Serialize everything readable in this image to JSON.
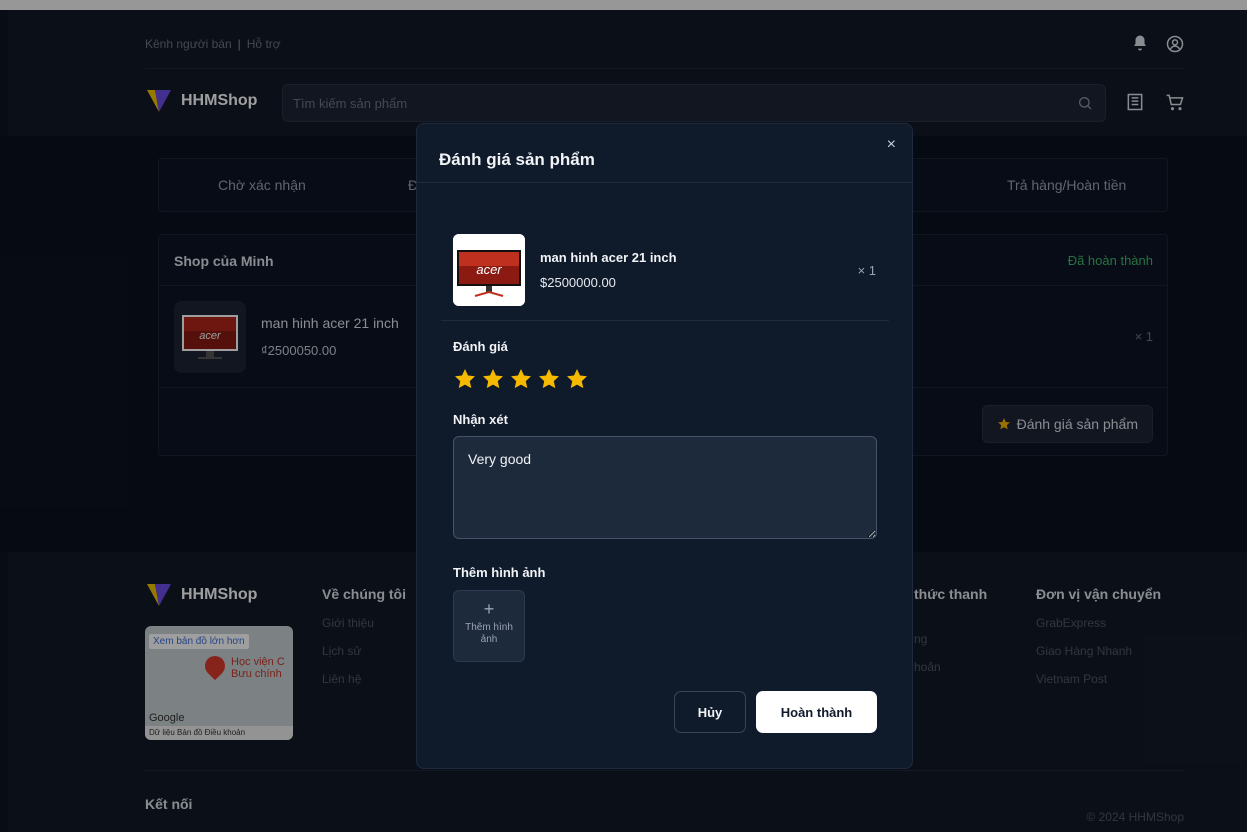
{
  "header": {
    "seller_channel": "Kênh người bán",
    "divider": "|",
    "support": "Hỗ trợ",
    "brand": "HHMShop",
    "search_placeholder": "Tìm kiếm sản phẩm"
  },
  "tabs": [
    {
      "label": "Chờ xác nhận"
    },
    {
      "label": "Đ"
    },
    {
      "label": "Trả hàng/Hoàn tiền"
    }
  ],
  "order": {
    "shop_name": "Shop của Minh",
    "status": "Đã hoàn thành",
    "product_name": "man hinh acer 21 inch",
    "product_price": "₫2500050.00",
    "quantity": "× 1",
    "rate_button": "Đánh giá sản phẩm"
  },
  "footer": {
    "brand": "HHMShop",
    "about_title": "Về chúng tôi",
    "about_links": [
      "Giới thiệu",
      "Lịch sử",
      "Liên hệ"
    ],
    "payment_title": "thức thanh",
    "payment_links": [
      "ng",
      "hoản"
    ],
    "shipping_title": "Đơn vị vận chuyển",
    "shipping_links": [
      "GrabExpress",
      "Giao Hàng Nhanh",
      "Vietnam Post"
    ],
    "map_link": "Xem bản đồ lớn hơn",
    "map_place": "Học viện C Bưu chính",
    "map_brand": "Google",
    "map_footer": "Dữ liệu Bản đồ   Điều khoản",
    "connect": "Kết nối",
    "copyright": "© 2024 HHMShop"
  },
  "modal": {
    "title": "Đánh giá sản phẩm",
    "close": "×",
    "product_name": "man hinh acer 21 inch",
    "product_price": "$2500000.00",
    "quantity": "× 1",
    "rating_label": "Đánh giá",
    "rating_value": 5,
    "comment_label": "Nhận xét",
    "comment_value": "Very good",
    "image_label": "Thêm hình ảnh",
    "add_image_text": "Thêm hình ảnh",
    "add_image_plus": "+",
    "cancel": "Hủy",
    "submit": "Hoàn thành"
  },
  "colors": {
    "star": "#f5b900",
    "status_green": "#3fb96b",
    "logo_purple": "#6b4de6",
    "logo_yellow": "#f5c400"
  }
}
